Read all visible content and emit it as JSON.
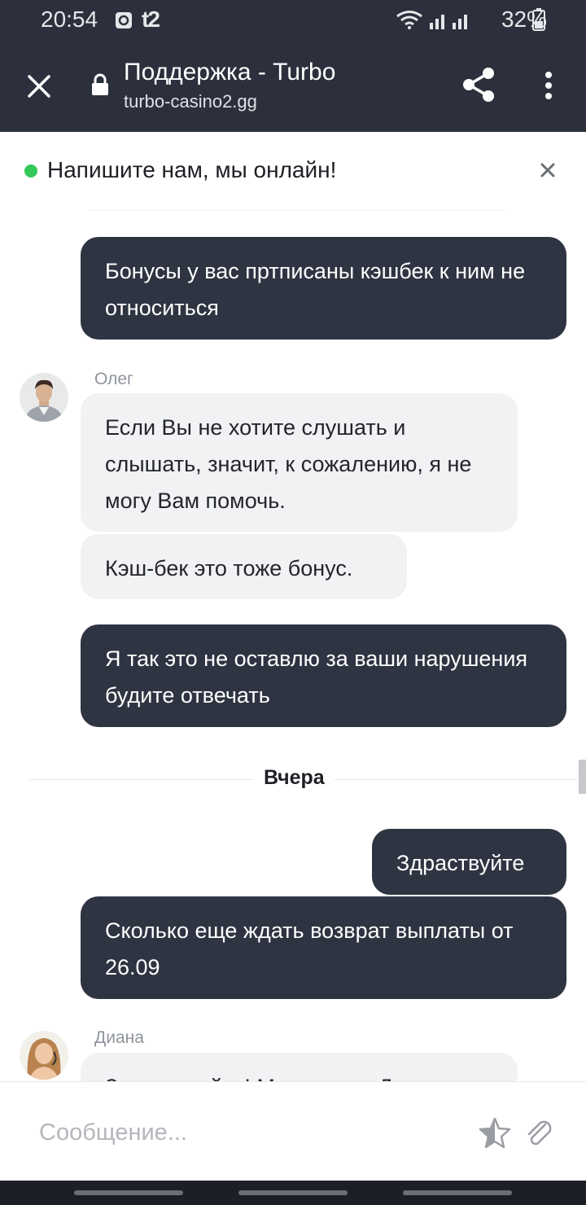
{
  "status_bar": {
    "time": "20:54",
    "carrier": "t2",
    "battery": "32%",
    "icons": [
      "alarm-icon",
      "wifi-icon",
      "signal-icon",
      "battery-icon"
    ]
  },
  "browser": {
    "title": "Поддержка - Turbo",
    "url": "turbo-casino2.gg",
    "icons": [
      "close-icon",
      "lock-icon",
      "share-icon",
      "more-vert-icon"
    ]
  },
  "chat_header": {
    "title": "Напишите нам, мы онлайн!",
    "status_color": "#34c759"
  },
  "agents": {
    "oleg": "Олег",
    "diana": "Диана"
  },
  "messages": {
    "m1": "Бонусы у вас пртписаны кэшбек к ним не относиться",
    "m2": "Если Вы не хотите слушать и слышать, значит, к сожалению, я не могу Вам помочь.",
    "m3": "Кэш-бек это тоже бонус.",
    "m4": "Я так это не оставлю за ваши нарушения будите отвечать",
    "m5": "Здраствуйте",
    "m6": "Сколько еще ждать возврат выплаты от 26.09",
    "m7": "Здравствуйте! Меня зовут Диана"
  },
  "day_separator": "Вчера",
  "composer": {
    "placeholder": "Сообщение...",
    "icons": [
      "star-icon",
      "attach-icon"
    ]
  },
  "colors": {
    "outgoing_bubble": "#2f3442",
    "incoming_bubble": "#f1f2f4",
    "top_bar": "#2b303c"
  }
}
